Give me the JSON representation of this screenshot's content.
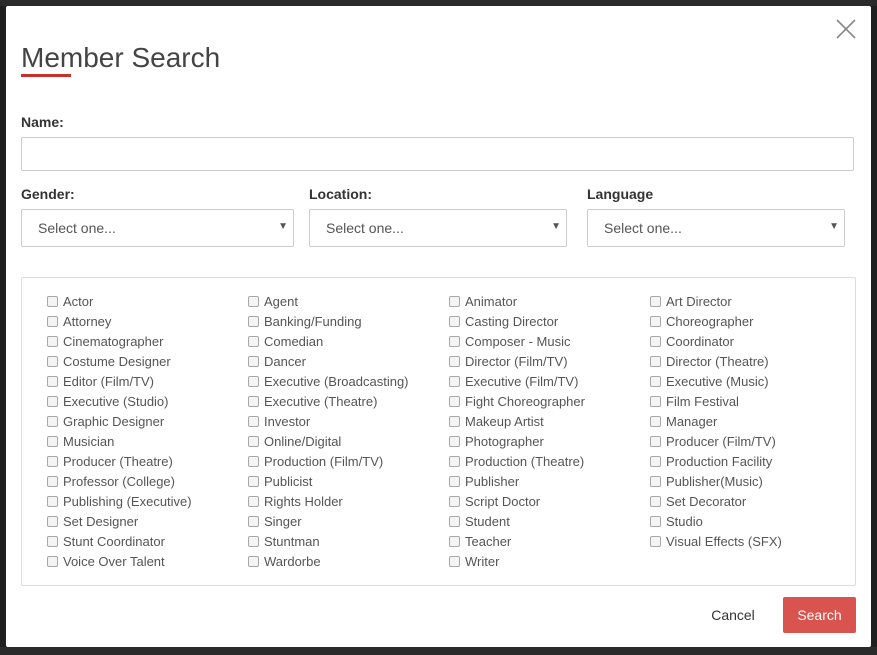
{
  "modal": {
    "title": "Member Search",
    "name_label": "Name:",
    "name_value": "",
    "gender_label": "Gender:",
    "gender_value": "Select one...",
    "location_label": "Location:",
    "location_value": "Select one...",
    "language_label": "Language",
    "language_value": "Select one...",
    "cancel_label": "Cancel",
    "search_label": "Search",
    "accent_color": "#d9534f"
  },
  "roles": [
    [
      "Actor",
      "Agent",
      "Animator",
      "Art Director"
    ],
    [
      "Attorney",
      "Banking/Funding",
      "Casting Director",
      "Choreographer"
    ],
    [
      "Cinematographer",
      "Comedian",
      "Composer - Music",
      "Coordinator"
    ],
    [
      "Costume Designer",
      "Dancer",
      "Director (Film/TV)",
      "Director (Theatre)"
    ],
    [
      "Editor (Film/TV)",
      "Executive (Broadcasting)",
      "Executive (Film/TV)",
      "Executive (Music)"
    ],
    [
      "Executive (Studio)",
      "Executive (Theatre)",
      "Fight Choreographer",
      "Film Festival"
    ],
    [
      "Graphic Designer",
      "Investor",
      "Makeup Artist",
      "Manager"
    ],
    [
      "Musician",
      "Online/Digital",
      "Photographer",
      "Producer (Film/TV)"
    ],
    [
      "Producer (Theatre)",
      "Production (Film/TV)",
      "Production (Theatre)",
      "Production Facility"
    ],
    [
      "Professor (College)",
      "Publicist",
      "Publisher",
      "Publisher(Music)"
    ],
    [
      "Publishing (Executive)",
      "Rights Holder",
      "Script Doctor",
      "Set Decorator"
    ],
    [
      "Set Designer",
      "Singer",
      "Student",
      "Studio"
    ],
    [
      "Stunt Coordinator",
      "Stuntman",
      "Teacher",
      "Visual Effects (SFX)"
    ],
    [
      "Voice Over Talent",
      "Wardorbe",
      "Writer"
    ]
  ],
  "icons": {
    "close": "close-icon",
    "caret": "chevron-down-icon",
    "checkbox": "checkbox-icon"
  }
}
